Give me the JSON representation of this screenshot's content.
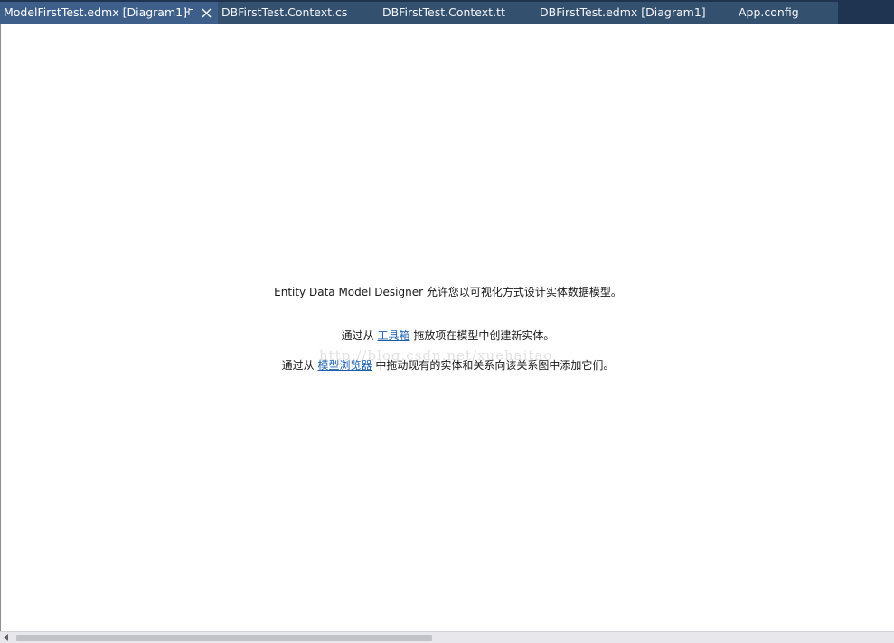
{
  "tabs": [
    {
      "label": "ModelFirstTest.edmx [Diagram1]",
      "active": true
    },
    {
      "label": "DBFirstTest.Context.cs",
      "active": false
    },
    {
      "label": "DBFirstTest.Context.tt",
      "active": false
    },
    {
      "label": "DBFirstTest.edmx [Diagram1]",
      "active": false
    },
    {
      "label": "App.config",
      "active": false
    }
  ],
  "designer": {
    "line1": "Entity Data Model Designer 允许您以可视化方式设计实体数据模型。",
    "line2_prefix": "通过从 ",
    "line2_link": "工具箱",
    "line2_suffix": " 拖放项在模型中创建新实体。",
    "line3_prefix": "通过从 ",
    "line3_link": "模型浏览器",
    "line3_suffix": " 中拖动现有的实体和关系向该关系图中添加它们。"
  },
  "watermark": "http://blog.csdn.net/xuehaitao",
  "colors": {
    "tabstrip": "#1e3451",
    "active_tab": "#3e5f8a",
    "inactive_tab": "#34506f",
    "link": "#1b5fae"
  },
  "icons": {
    "pin": "pin-icon",
    "close": "close-icon",
    "scroll_left": "arrow-left-icon"
  }
}
